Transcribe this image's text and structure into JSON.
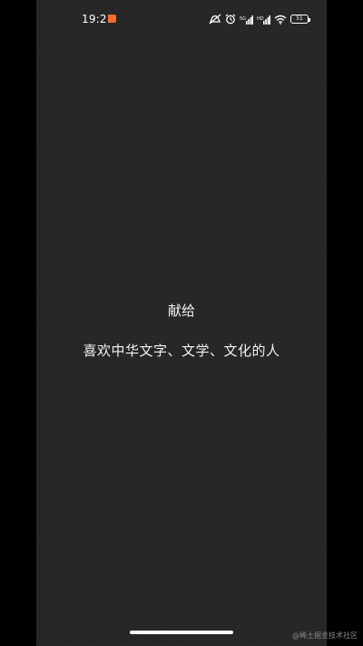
{
  "status_bar": {
    "time": "19:21",
    "app_badge_icon": "xiaomi-badge-icon",
    "icons": [
      "silent-icon",
      "alarm-icon",
      "signal-1-icon",
      "signal-2-icon",
      "wifi-icon"
    ],
    "battery_level": "51"
  },
  "content": {
    "dedication_title": "献给",
    "dedication_text": "喜欢中华文字、文学、文化的人"
  },
  "watermark": "@稀土掘金技术社区",
  "colors": {
    "screen_background": "#262626",
    "outer_background": "#000000",
    "text": "#f2f2f2",
    "badge": "#ff6a2b"
  }
}
